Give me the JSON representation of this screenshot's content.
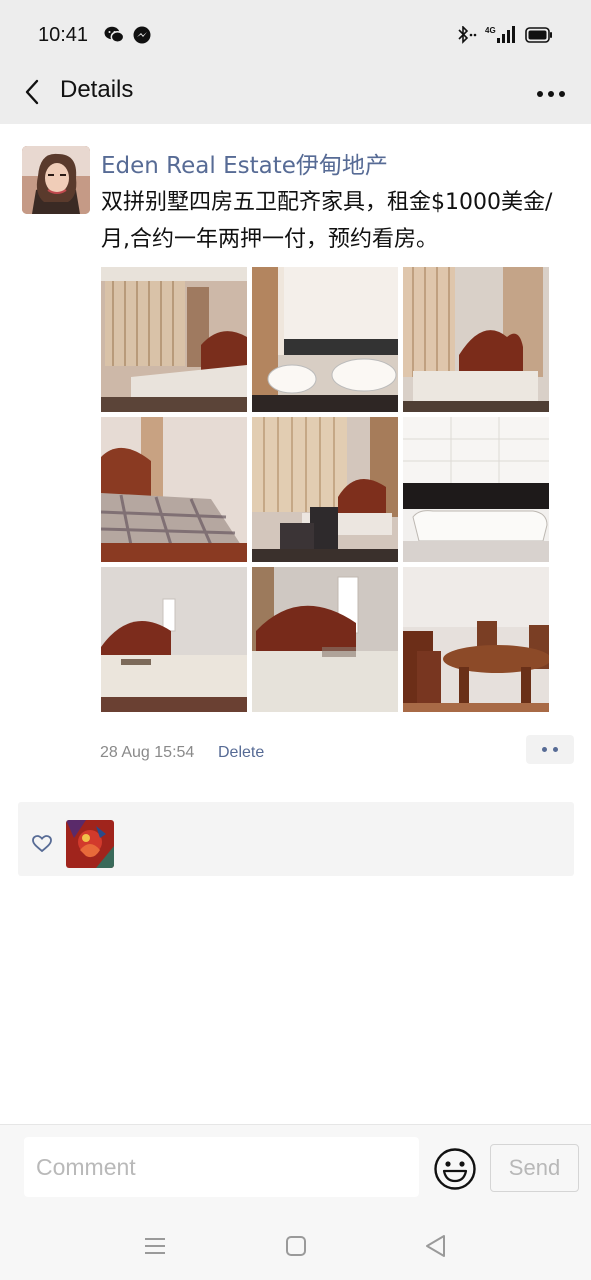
{
  "status_bar": {
    "time": "10:41",
    "network": "4G",
    "icons": [
      "wechat-icon",
      "messenger-icon",
      "bluetooth-icon",
      "signal-icon",
      "battery-icon"
    ]
  },
  "nav": {
    "title": "Details",
    "icons": [
      "back-arrow-icon",
      "more-icon"
    ]
  },
  "post": {
    "poster_name": "Eden Real Estate伊甸地产",
    "text": "双拼别墅四房五卫配齐家具，租金$1000美金/月,合约一年两押一付，预约看房。",
    "photos": [
      "bedroom-curtains-photo",
      "bathroom-sink-tub-photo",
      "bedroom-carved-bed-photo",
      "bedroom-plaid-bed-photo",
      "bedroom-desk-chair-photo",
      "bathroom-bathtub-photo",
      "bedroom-window-bed-photo",
      "bedroom-carved-bed-2-photo",
      "dining-table-chairs-photo"
    ],
    "timestamp": "28 Aug 15:54",
    "delete_label": "Delete"
  },
  "likes": {
    "icon": "heart-icon",
    "likers": [
      "liker-avatar"
    ]
  },
  "comment_bar": {
    "placeholder": "Comment",
    "send_label": "Send",
    "emoji_icon": "emoji-icon"
  },
  "system_nav": [
    "menu-icon",
    "home-icon",
    "back-icon"
  ],
  "colors": {
    "link": "#576b95",
    "header_bg": "#ededed",
    "meta_gray": "#8a8a8a"
  }
}
